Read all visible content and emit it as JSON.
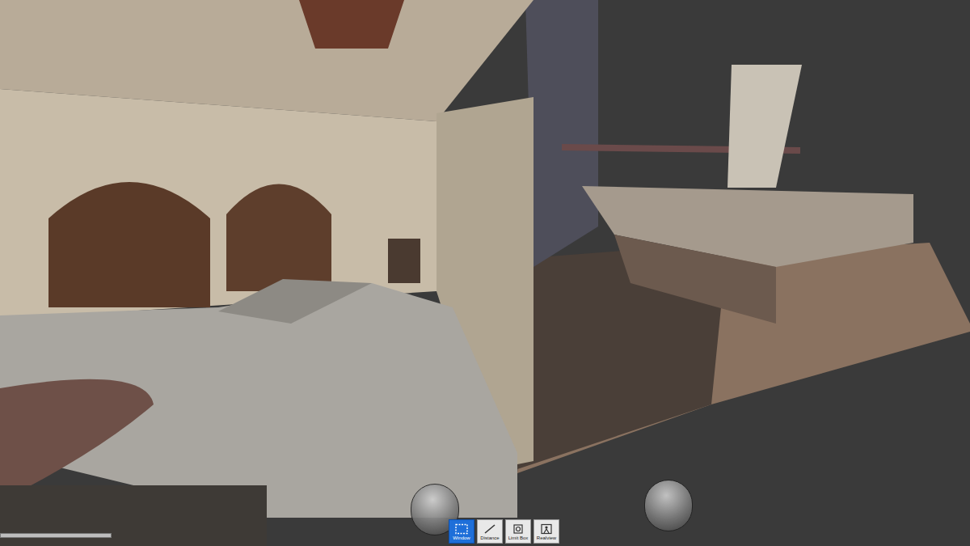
{
  "toolbar": [
    {
      "label": "Window",
      "selected": true
    },
    {
      "label": "Distance",
      "selected": false
    },
    {
      "label": "Limit Box",
      "selected": false
    },
    {
      "label": "Realview",
      "selected": false
    }
  ]
}
